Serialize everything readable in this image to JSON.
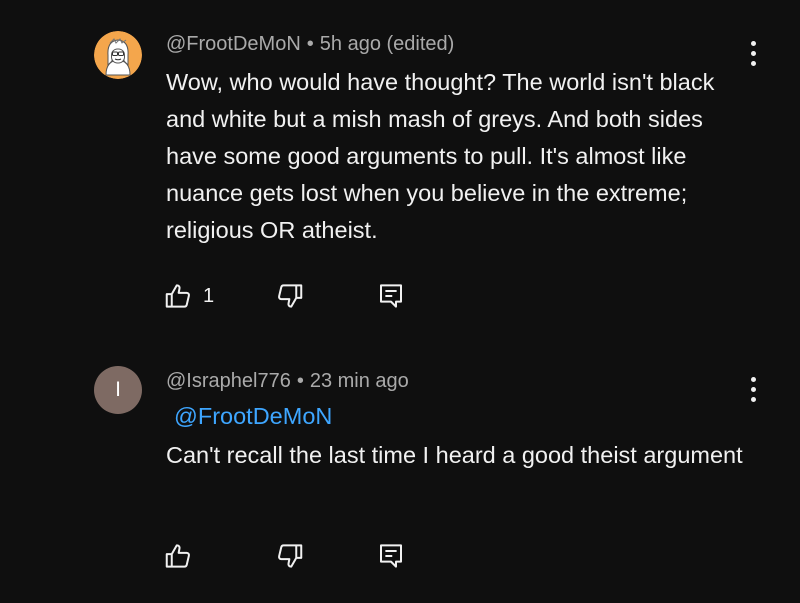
{
  "comments": [
    {
      "author": "@FrootDeMoN",
      "separator": "•",
      "time": "5h ago (edited)",
      "text": "Wow, who would have thought? The world isn't black and white but a mish mash of greys. And both sides have some good arguments to pull. It's almost like nuance gets lost when you believe in the extreme; religious OR atheist.",
      "likes": "1",
      "avatar": {
        "type": "cartoon",
        "bg": "#f4a64c"
      }
    },
    {
      "author": "@Israphel776",
      "separator": "•",
      "time": "23 min ago",
      "mention": "@FrootDeMoN",
      "text": "Can't recall the last time I heard a good theist argument",
      "likes": "",
      "avatar": {
        "type": "letter",
        "letter": "I",
        "bg": "#7e6a63"
      }
    }
  ],
  "icons": {
    "like": "thumbs-up-icon",
    "dislike": "thumbs-down-icon",
    "reply": "reply-icon",
    "menu": "more-vert-icon"
  },
  "colors": {
    "background": "#0f0f0f",
    "text": "#f1f1f1",
    "meta": "#aaaaaa",
    "mention": "#3ea6ff"
  }
}
